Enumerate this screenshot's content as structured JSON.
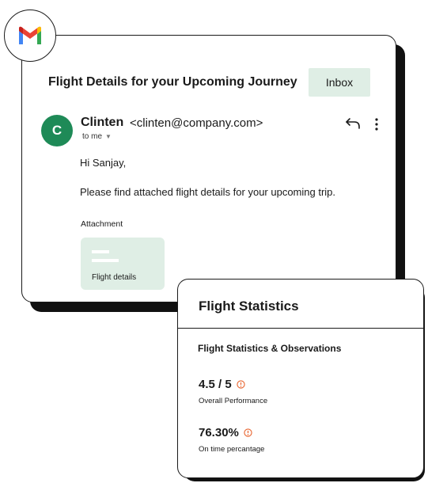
{
  "app": {
    "icon": "gmail-icon"
  },
  "email": {
    "subject": "Flight Details for your Upcoming Journey",
    "folder_chip": "Inbox",
    "sender": {
      "initial": "C",
      "name": "Clinten",
      "email": "<clinten@company.com>",
      "to": "to me",
      "avatar_color": "#1e8a57"
    },
    "greeting": "Hi Sanjay,",
    "body": "Please find attached flight details for your upcoming trip.",
    "attachment_label": "Attachment",
    "attachment_name": "Flight details",
    "actions": {
      "reply_icon": "reply-icon",
      "more_icon": "more-vertical-icon"
    }
  },
  "stats": {
    "title": "Flight Statistics",
    "subtitle": "Flight Statistics & Observations",
    "metrics": [
      {
        "value": "4.5 / 5",
        "label": "Overall Performance",
        "icon": "info-icon"
      },
      {
        "value": "76.30%",
        "label": "On time percantage",
        "icon": "info-icon"
      }
    ]
  },
  "colors": {
    "accent_green": "#1e8a57",
    "chip_bg": "#dfeee5",
    "info_orange": "#e8622c"
  }
}
